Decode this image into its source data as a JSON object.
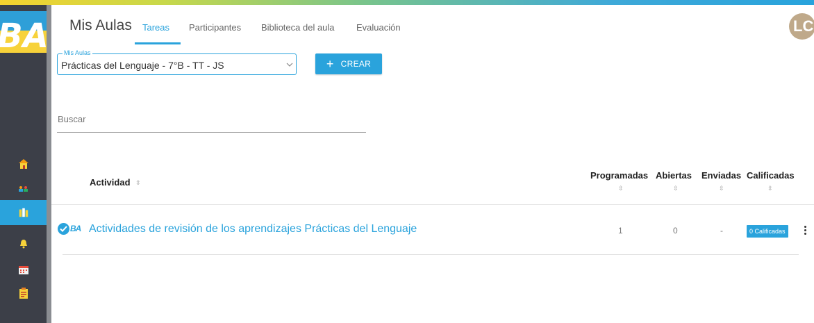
{
  "header": {
    "title": "Mis Aulas",
    "tabs": [
      "Tareas",
      "Participantes",
      "Biblioteca del aula",
      "Evaluación"
    ],
    "active_tab": "Tareas",
    "avatar_initials": "LC"
  },
  "logo": {
    "text": "BA"
  },
  "sidebar": {
    "icons": [
      "school-icon",
      "students-icon",
      "classroom-icon",
      "bell-icon",
      "calendar-icon",
      "clipboard-icon"
    ],
    "active": "classroom-icon"
  },
  "controls": {
    "select_label": "Mis Aulas",
    "select_value": "Prácticas del Lenguaje - 7°B - TT - JS",
    "create_label": "CREAR",
    "search_placeholder": "Buscar"
  },
  "table": {
    "columns": [
      "Actividad",
      "Programadas",
      "Abiertas",
      "Enviadas",
      "Calificadas"
    ],
    "rows": [
      {
        "badge_text": "BA",
        "title": "Actividades de revisión de los aprendizajes Prácticas del Lenguaje",
        "programadas": "1",
        "abiertas": "0",
        "enviadas": "-",
        "calificadas": "0 Calificadas"
      }
    ]
  },
  "colors": {
    "accent": "#2aa3dc",
    "sidebar": "#3c3f48"
  }
}
